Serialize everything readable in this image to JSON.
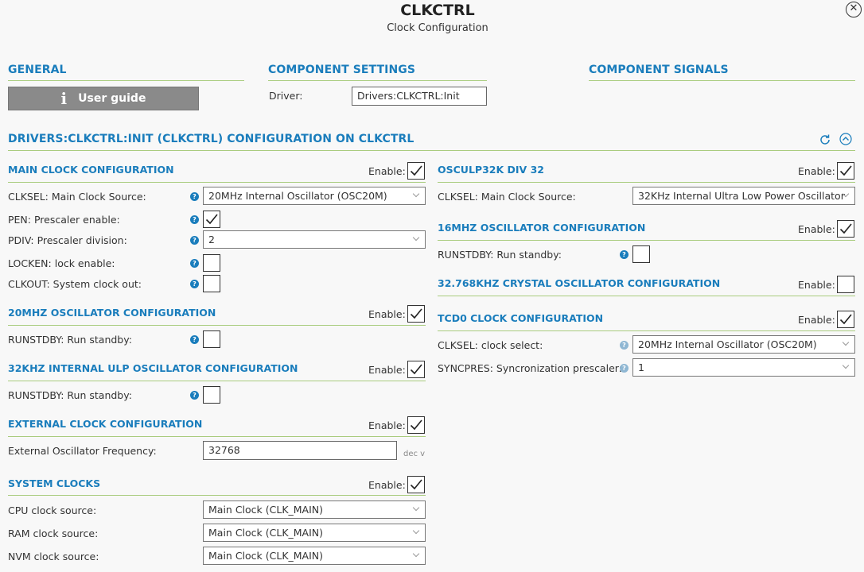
{
  "header": {
    "title": "CLKCTRL",
    "subtitle": "Clock Configuration"
  },
  "general": {
    "title": "GENERAL",
    "user_guide_label": "User guide"
  },
  "component_settings": {
    "title": "COMPONENT SETTINGS",
    "driver_label": "Driver:",
    "driver_value": "Drivers:CLKCTRL:Init"
  },
  "component_signals": {
    "title": "COMPONENT SIGNALS"
  },
  "config": {
    "title": "DRIVERS:CLKCTRL:INIT (CLKCTRL) CONFIGURATION ON CLKCTRL"
  },
  "enable_label": "Enable:",
  "main_clock": {
    "title": "MAIN CLOCK CONFIGURATION",
    "clksel_label": "CLKSEL: Main Clock Source:",
    "clksel_value": "20MHz Internal Oscillator (OSC20M)",
    "pen_label": "PEN: Prescaler enable:",
    "pdiv_label": "PDIV: Prescaler division:",
    "pdiv_value": "2",
    "locken_label": "LOCKEN: lock enable:",
    "clkout_label": "CLKOUT: System clock out:"
  },
  "osc20m": {
    "title": "20MHZ OSCILLATOR CONFIGURATION",
    "runstdby_label": "RUNSTDBY: Run standby:"
  },
  "osc32k": {
    "title": "32KHZ INTERNAL ULP OSCILLATOR CONFIGURATION",
    "runstdby_label": "RUNSTDBY: Run standby:"
  },
  "ext_clock": {
    "title": "EXTERNAL CLOCK CONFIGURATION",
    "freq_label": "External Oscillator Frequency:",
    "freq_value": "32768",
    "unit": "dec v"
  },
  "sys_clocks": {
    "title": "SYSTEM CLOCKS",
    "cpu_label": "CPU clock source:",
    "cpu_value": "Main Clock (CLK_MAIN)",
    "ram_label": "RAM clock source:",
    "ram_value": "Main Clock (CLK_MAIN)",
    "nvm_label": "NVM clock source:",
    "nvm_value": "Main Clock (CLK_MAIN)"
  },
  "osculp_div32": {
    "title": "OSCULP32K DIV 32",
    "clksel_label": "CLKSEL: Main Clock Source:",
    "clksel_value": "32KHz Internal Ultra Low Power Oscillator"
  },
  "osc16m": {
    "title": "16MHZ OSCILLATOR CONFIGURATION",
    "runstdby_label": "RUNSTDBY: Run standby:"
  },
  "xosc32k": {
    "title": "32.768KHZ CRYSTAL OSCILLATOR CONFIGURATION"
  },
  "tcd0": {
    "title": "TCD0 CLOCK CONFIGURATION",
    "clksel_label": "CLKSEL: clock select:",
    "clksel_value": "20MHz Internal Oscillator (OSC20M)",
    "syncpres_label": "SYNCPRES: Syncronization prescaler:",
    "syncpres_value": "1"
  },
  "checkboxes": {
    "main_enable": true,
    "pen": true,
    "locken": false,
    "clkout": false,
    "osc20m_enable": true,
    "osc20m_runstdby": false,
    "osc32k_enable": true,
    "osc32k_runstdby": false,
    "ext_enable": true,
    "sys_enable": true,
    "osculp_enable": true,
    "osc16m_enable": true,
    "osc16m_runstdby": false,
    "xosc32k_enable": false,
    "tcd0_enable": true
  },
  "icons": {
    "close": "close-icon",
    "info": "info-icon",
    "help": "help-icon",
    "refresh": "refresh-icon",
    "collapse": "collapse-icon"
  },
  "colors": {
    "accent": "#1a7dbc",
    "divider": "#a9cc7e",
    "button": "#8a8a8a"
  }
}
